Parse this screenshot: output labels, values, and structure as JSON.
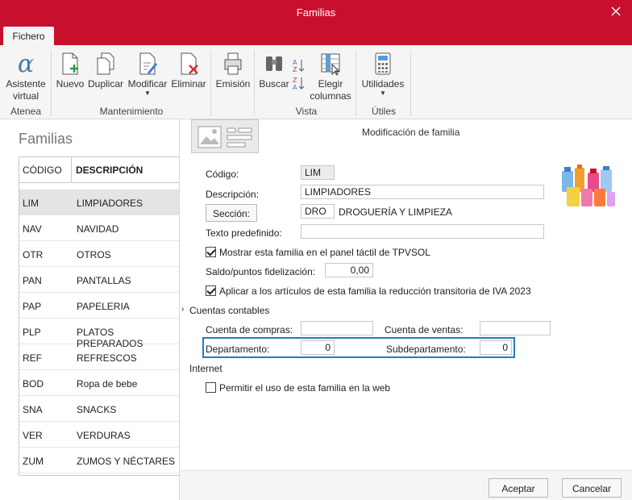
{
  "window": {
    "title": "Familias"
  },
  "menu": {
    "tab": "Fichero"
  },
  "ribbon": {
    "groups": {
      "atenea": "Atenea",
      "mantenimiento": "Mantenimiento",
      "vista": "Vista",
      "utiles": "Útiles"
    },
    "buttons": {
      "asistente_line1": "Asistente",
      "asistente_line2": "virtual",
      "nuevo": "Nuevo",
      "duplicar": "Duplicar",
      "modificar": "Modificar",
      "eliminar": "Eliminar",
      "emision": "Emisión",
      "buscar": "Buscar",
      "elegir_line1": "Elegir",
      "elegir_line2": "columnas",
      "utilidades": "Utilidades"
    }
  },
  "list": {
    "title": "Familias",
    "headers": {
      "codigo": "CÓDIGO",
      "descripcion": "DESCRIPCIÓN"
    },
    "rows": [
      {
        "code": "LIM",
        "desc": "LIMPIADORES"
      },
      {
        "code": "NAV",
        "desc": "NAVIDAD"
      },
      {
        "code": "OTR",
        "desc": "OTROS"
      },
      {
        "code": "PAN",
        "desc": "PANTALLAS"
      },
      {
        "code": "PAP",
        "desc": "PAPELERIA"
      },
      {
        "code": "PLP",
        "desc": "PLATOS PREPARADOS"
      },
      {
        "code": "REF",
        "desc": "REFRESCOS"
      },
      {
        "code": "BOD",
        "desc": "Ropa de bebe"
      },
      {
        "code": "SNA",
        "desc": "SNACKS"
      },
      {
        "code": "VER",
        "desc": "VERDURAS"
      },
      {
        "code": "ZUM",
        "desc": "ZUMOS Y NÉCTARES"
      }
    ]
  },
  "form": {
    "title": "Modificación de familia",
    "codigo_label": "Código:",
    "codigo_value": "LIM",
    "descripcion_label": "Descripción:",
    "descripcion_value": "LIMPIADORES",
    "seccion_button": "Sección:",
    "seccion_code": "DRO",
    "seccion_name": "DROGUERÍA Y LIMPIEZA",
    "texto_label": "Texto predefinido:",
    "texto_value": "",
    "mostrar_label": "Mostrar esta familia en el panel táctil de TPVSOL",
    "mostrar_checked": true,
    "saldo_label": "Saldo/puntos fidelización:",
    "saldo_value": "0,00",
    "aplicar_label": "Aplicar a los artículos de esta familia la reducción transitoria de IVA 2023",
    "aplicar_checked": true,
    "cuentas_label": "Cuentas contables",
    "compras_label": "Cuenta de compras:",
    "compras_value": "",
    "ventas_label": "Cuenta de ventas:",
    "ventas_value": "",
    "departamento_label": "Departamento:",
    "departamento_value": "0",
    "subdepartamento_label": "Subdepartamento:",
    "subdepartamento_value": "0",
    "internet_label": "Internet",
    "permitir_label": "Permitir el uso de esta familia en la web",
    "permitir_checked": false
  },
  "footer": {
    "aceptar": "Aceptar",
    "cancelar": "Cancelar"
  },
  "colors": {
    "brand": "#c8102e",
    "highlight": "#1f7fbf"
  }
}
